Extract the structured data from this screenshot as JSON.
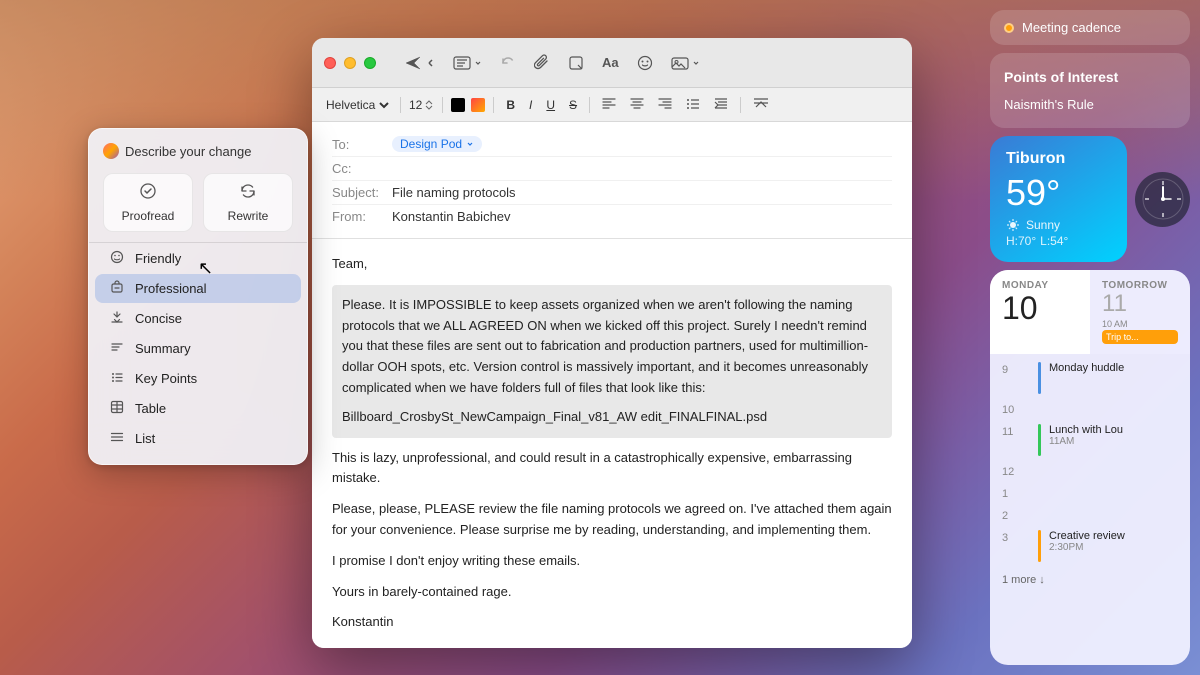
{
  "desktop": {
    "bg_desc": "macOS desktop with warm gradient landscape"
  },
  "email_window": {
    "title": "File naming protocols",
    "traffic_lights": [
      "close",
      "minimize",
      "maximize"
    ],
    "toolbar": {
      "send_label": "Send",
      "font": "Helvetica",
      "font_size": "12",
      "bold": "B",
      "italic": "I",
      "underline": "U",
      "strikethrough": "S"
    },
    "to_label": "To:",
    "to_recipient": "Design Pod",
    "cc_label": "Cc:",
    "subject_label": "Subject:",
    "subject_value": "File naming protocols",
    "from_label": "From:",
    "from_value": "Konstantin Babichev",
    "body_greeting": "Team,",
    "body_highlighted": "Please. It is IMPOSSIBLE to keep assets organized when we aren't following the naming protocols that we ALL AGREED ON when we kicked off this project. Surely I needn't remind you that these files are sent out to fabrication and production partners, used for multimillion-dollar OOH spots, etc. Version control is massively important, and it becomes unreasonably complicated when we have folders full of files that look like this:",
    "body_filename": "Billboard_CrosbySt_NewCampaign_Final_v81_AW edit_FINALFINAL.psd",
    "body_para2": "This is lazy, unprofessional, and could result in a catastrophically expensive, embarrassing mistake.",
    "body_para3": "Please, please, PLEASE review the file naming protocols we agreed on. I've attached them again for your convenience. Please surprise me by reading, understanding, and implementing them.",
    "body_para4": "I promise I don't enjoy writing these emails.",
    "body_closing": "Yours in barely-contained rage.",
    "body_signature": "Konstantin"
  },
  "ai_popup": {
    "header": "Describe your change",
    "proofread_label": "Proofread",
    "rewrite_label": "Rewrite",
    "menu_items": [
      {
        "label": "Friendly",
        "icon": "circle-smile"
      },
      {
        "label": "Professional",
        "icon": "briefcase",
        "active": true
      },
      {
        "label": "Concise",
        "icon": "asterisk"
      },
      {
        "label": "Summary",
        "icon": "lines"
      },
      {
        "label": "Key Points",
        "icon": "list"
      },
      {
        "label": "Table",
        "icon": "table-icon"
      },
      {
        "label": "List",
        "icon": "list-icon"
      }
    ]
  },
  "widgets": {
    "meeting_cadence": "Meeting cadence",
    "poi_title": "Points of Interest",
    "poi_item": "Naismith's Rule",
    "weather": {
      "location": "Tiburon",
      "temp": "59°",
      "condition": "Sunny",
      "hi": "H:70°",
      "lo": "L:54°"
    },
    "calendar": {
      "today_label": "MONDAY",
      "today_date": "10",
      "tomorrow_label": "TOMORROW",
      "time_row": {
        "time": "10 AM",
        "event": "Trip to..."
      },
      "events": [
        {
          "time": "9",
          "title": "Monday huddle",
          "color": "#4a90e2"
        },
        {
          "time": "10",
          "title": "",
          "color": ""
        },
        {
          "time": "11",
          "title": "Lunch with Lou",
          "sub": "11AM",
          "color": "#34c759"
        },
        {
          "time": "12",
          "title": "",
          "color": ""
        },
        {
          "time": "1",
          "title": "",
          "color": ""
        },
        {
          "time": "2",
          "title": "",
          "color": ""
        },
        {
          "time": "3",
          "title": "Creative review",
          "sub": "2:30PM",
          "color": "#ff9f0a"
        }
      ],
      "more": "1 more ↓"
    }
  }
}
